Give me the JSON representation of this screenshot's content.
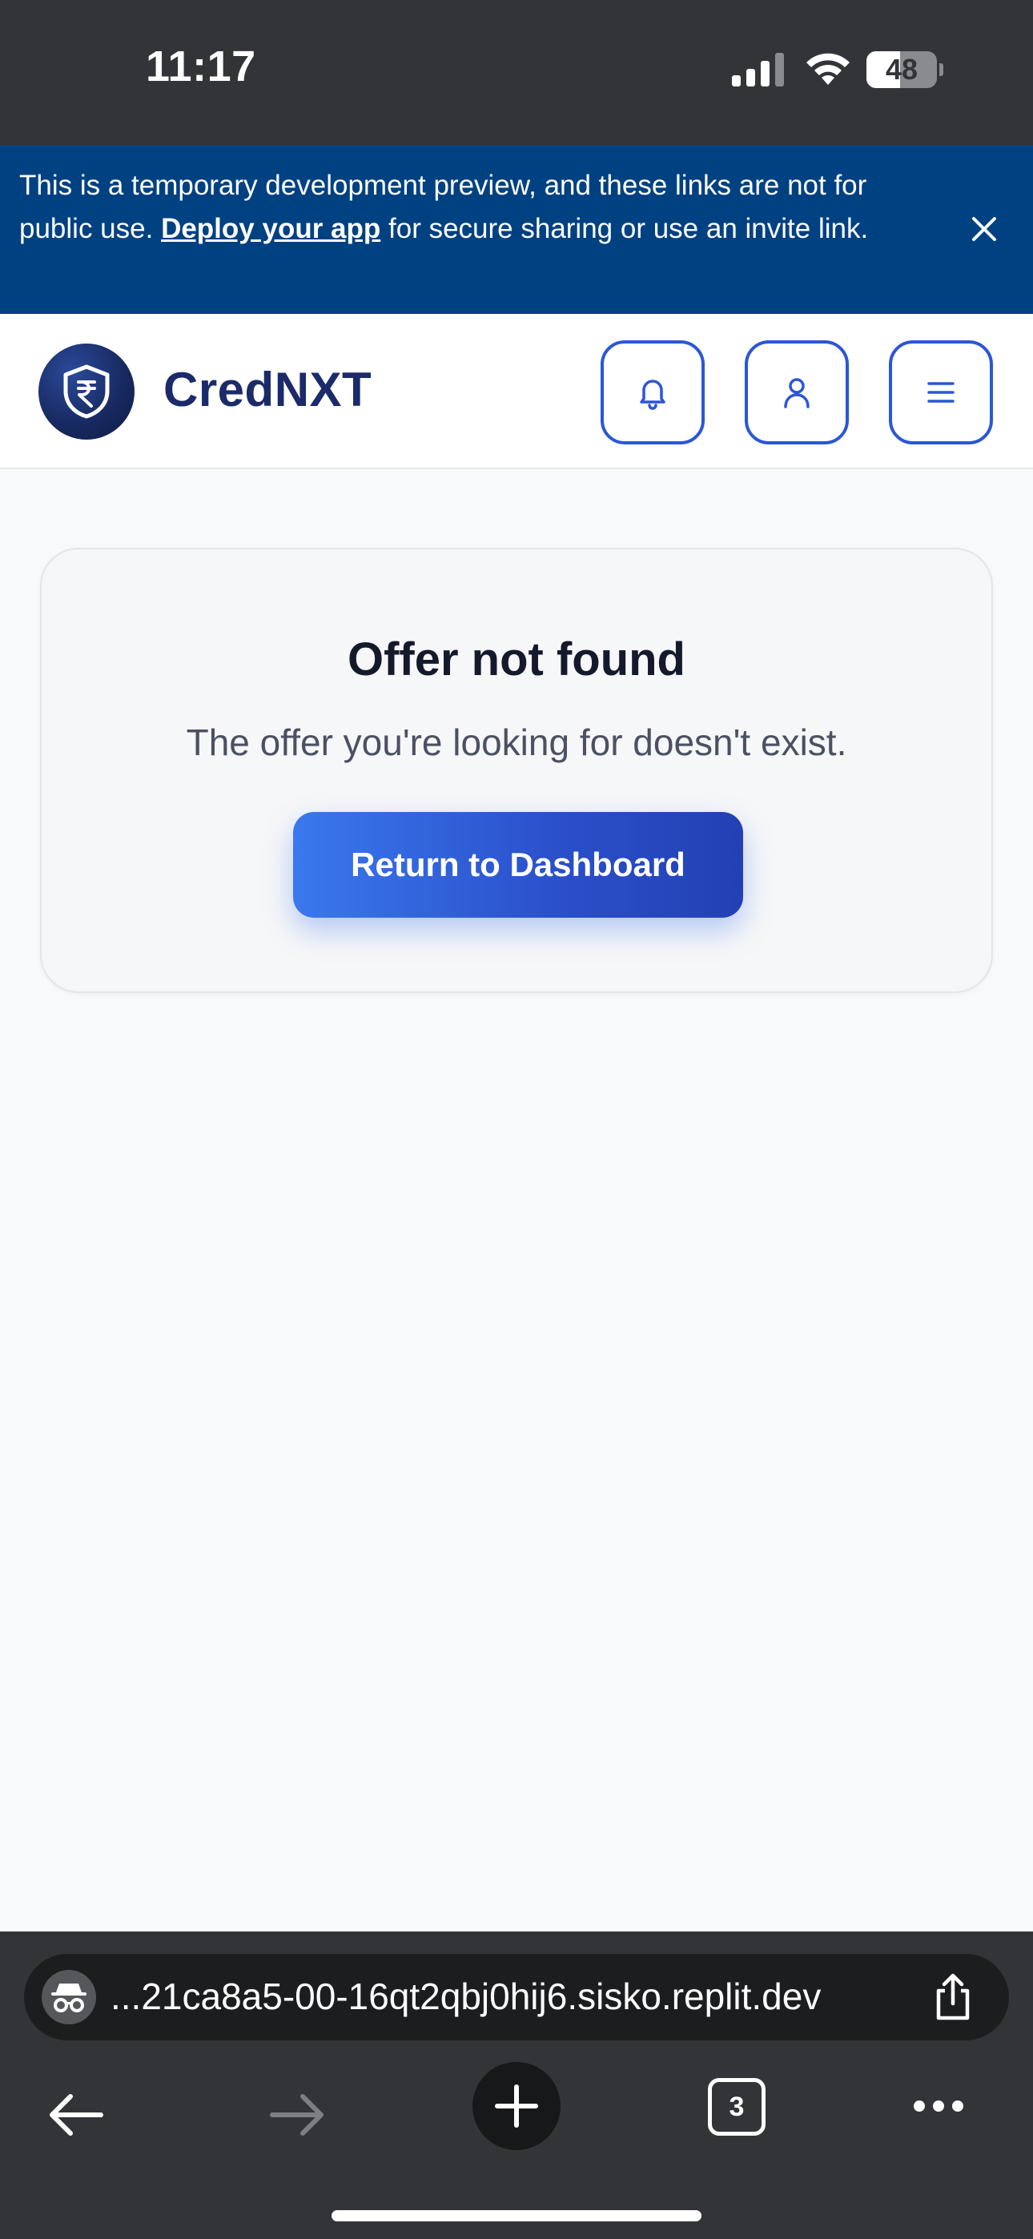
{
  "status_bar": {
    "time": "11:17",
    "battery": "48",
    "battery_level": 0.48
  },
  "dev_banner": {
    "text_before_link": "This is a temporary development preview, and these links are not for public use. ",
    "link_text": "Deploy your app",
    "text_after_link": " for secure sharing or use an invite link.",
    "close_icon": "close-icon",
    "background": "#004182"
  },
  "header": {
    "brand": "CredNXT",
    "logo_icon": "rupee-shield-icon",
    "buttons": [
      "bell-icon",
      "user-icon",
      "menu-icon"
    ],
    "accent": "#2b57d6"
  },
  "card": {
    "title": "Offer not found",
    "message": "The offer you're looking for doesn't exist.",
    "button_label": "Return to Dashboard"
  },
  "browser": {
    "url": "...21ca8a5-00-16qt2qbj0hij6.sisko.replit.dev",
    "tab_count": "3",
    "icons": [
      "incognito-icon",
      "share-icon",
      "back-arrow-icon",
      "forward-arrow-icon",
      "plus-icon",
      "ellipsis-icon"
    ]
  }
}
